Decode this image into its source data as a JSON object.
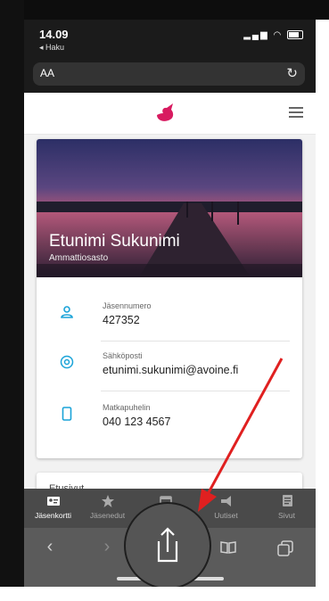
{
  "status_bar": {
    "time": "14.09",
    "back_label": "◂ Haku"
  },
  "address_bar": {
    "aa_label": "AA"
  },
  "profile": {
    "name": "Etunimi Sukunimi",
    "subtitle": "Ammattiosasto"
  },
  "fields": [
    {
      "label": "Jäsennumero",
      "value": "427352",
      "icon": "person-icon"
    },
    {
      "label": "Sähköposti",
      "value": "etunimi.sukunimi@avoine.fi",
      "icon": "at-icon"
    },
    {
      "label": "Matkapuhelin",
      "value": "040 123 4567",
      "icon": "phone-icon"
    }
  ],
  "next_card": {
    "title": "Etusivut"
  },
  "tabs": [
    {
      "label": "Jäsenkortti",
      "icon": "member-card-icon"
    },
    {
      "label": "Jäsenedut",
      "icon": "star-icon"
    },
    {
      "label": "",
      "icon": "calendar-icon"
    },
    {
      "label": "Uutiset",
      "icon": "megaphone-icon"
    },
    {
      "label": "Sivut",
      "icon": "pages-icon"
    }
  ],
  "colors": {
    "accent": "#d81b60",
    "icon_blue": "#1aa3d8",
    "arrow": "#e02020"
  }
}
